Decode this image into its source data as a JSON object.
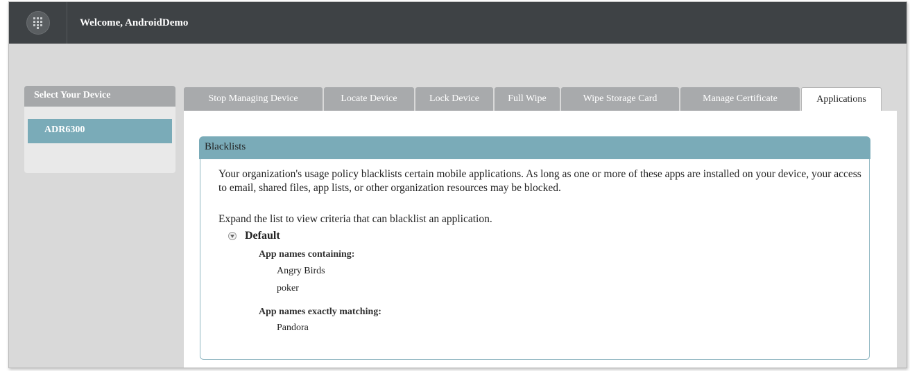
{
  "header": {
    "welcome": "Welcome, AndroidDemo",
    "logo_icon": "grid-logo-icon"
  },
  "sidebar": {
    "title": "Select Your Device",
    "devices": [
      "ADR6300"
    ]
  },
  "tabs": [
    {
      "label": "Stop Managing Device",
      "active": false
    },
    {
      "label": "Locate Device",
      "active": false
    },
    {
      "label": "Lock Device",
      "active": false
    },
    {
      "label": "Full Wipe",
      "active": false
    },
    {
      "label": "Wipe Storage Card",
      "active": false
    },
    {
      "label": "Manage Certificate",
      "active": false
    },
    {
      "label": "Applications",
      "active": true
    }
  ],
  "blacklists": {
    "title": "Blacklists",
    "policy_text": "Your organization's usage policy blacklists certain mobile applications. As long as one or more of these apps are installed on your device, your access to email, shared files, app lists, or other organization resources may be blocked.",
    "expand_text": "Expand the list to view criteria that can blacklist an application.",
    "group_label": "Default",
    "containing_heading": "App names containing:",
    "containing_items": [
      "Angry Birds",
      "poker"
    ],
    "matching_heading": "App names exactly matching:",
    "matching_items": [
      "Pandora"
    ]
  },
  "colors": {
    "topbar": "#3e4245",
    "accent": "#7aabb8",
    "tab_inactive": "#a8aaac",
    "background": "#d9d9d9"
  }
}
